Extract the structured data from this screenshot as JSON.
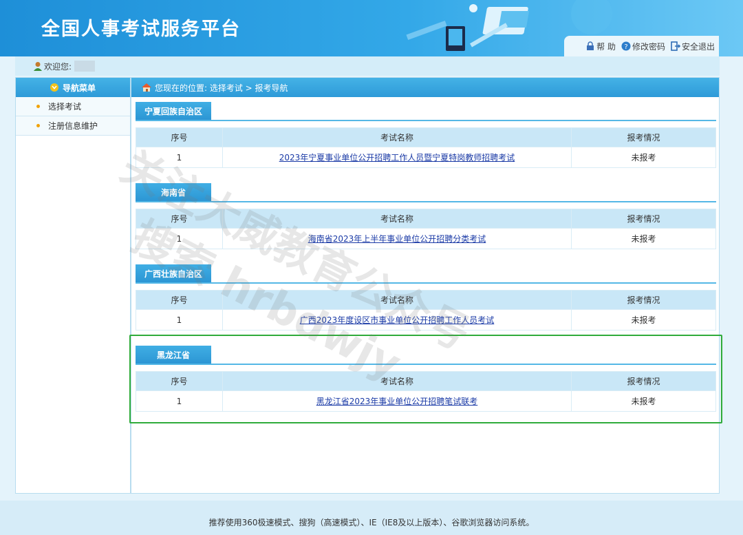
{
  "header": {
    "title": "全国人事考试服务平台",
    "links": {
      "help": "帮 助",
      "change_password": "修改密码",
      "logout": "安全退出"
    }
  },
  "welcome": {
    "label": "欢迎您:"
  },
  "sidebar": {
    "heading": "导航菜单",
    "items": [
      {
        "label": "选择考试"
      },
      {
        "label": "注册信息维护"
      }
    ]
  },
  "breadcrumb": {
    "text": "您现在的位置: 选择考试 > 报考导航"
  },
  "table_headers": {
    "index": "序号",
    "name": "考试名称",
    "status": "报考情况"
  },
  "sections": [
    {
      "region": "宁夏回族自治区",
      "rows": [
        {
          "index": "1",
          "name": "2023年宁夏事业单位公开招聘工作人员暨宁夏特岗教师招聘考试",
          "status": "未报考"
        }
      ]
    },
    {
      "region": "海南省",
      "rows": [
        {
          "index": "1",
          "name": "海南省2023年上半年事业单位公开招聘分类考试",
          "status": "未报考"
        }
      ]
    },
    {
      "region": "广西壮族自治区",
      "rows": [
        {
          "index": "1",
          "name": "广西2023年度设区市事业单位公开招聘工作人员考试",
          "status": "未报考"
        }
      ]
    },
    {
      "region": "黑龙江省",
      "rows": [
        {
          "index": "1",
          "name": "黑龙江省2023年事业单位公开招聘笔试联考",
          "status": "未报考"
        }
      ]
    }
  ],
  "watermark": {
    "line1": "关注大威教育公众号",
    "line2": "搜索 hrbdwjy"
  },
  "footer": {
    "text": "推荐使用360极速模式、搜狗（高速模式）、IE（IE8及以上版本）、谷歌浏览器访问系统。"
  },
  "colors": {
    "header_blue": "#1e8fd8",
    "highlight_green": "#2fab3a",
    "link_blue": "#1a3aa6"
  }
}
